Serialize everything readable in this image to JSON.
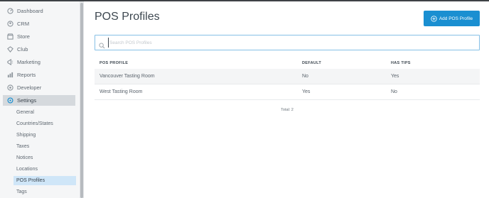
{
  "sidebar": {
    "items": [
      {
        "label": "Dashboard",
        "icon": "dashboard-icon"
      },
      {
        "label": "CRM",
        "icon": "crm-icon"
      },
      {
        "label": "Store",
        "icon": "store-icon"
      },
      {
        "label": "Club",
        "icon": "club-icon"
      },
      {
        "label": "Marketing",
        "icon": "marketing-icon"
      },
      {
        "label": "Reports",
        "icon": "reports-icon"
      },
      {
        "label": "Developer",
        "icon": "developer-icon"
      },
      {
        "label": "Settings",
        "icon": "gear-icon",
        "active": true
      }
    ],
    "sub_items": [
      {
        "label": "General"
      },
      {
        "label": "Countries/States"
      },
      {
        "label": "Shipping"
      },
      {
        "label": "Taxes"
      },
      {
        "label": "Notices"
      },
      {
        "label": "Locations"
      },
      {
        "label": "POS Profiles",
        "active": true
      },
      {
        "label": "Tags"
      }
    ]
  },
  "header": {
    "title": "POS Profiles",
    "add_button_label": "Add POS Profile"
  },
  "search": {
    "placeholder": "Search POS Profiles",
    "value": ""
  },
  "table": {
    "columns": [
      "POS PROFILE",
      "DEFAULT",
      "HAS TIPS"
    ],
    "rows": [
      {
        "profile": "Vancouver Tasting Room",
        "default": "No",
        "has_tips": "Yes"
      },
      {
        "profile": "West Tasting Room",
        "default": "Yes",
        "has_tips": "No"
      }
    ],
    "total_label": "Total: 2"
  },
  "colors": {
    "accent": "#1a8fd1",
    "active_sub_item": "#cfe6f8",
    "active_nav_item": "#d5d9dd"
  }
}
